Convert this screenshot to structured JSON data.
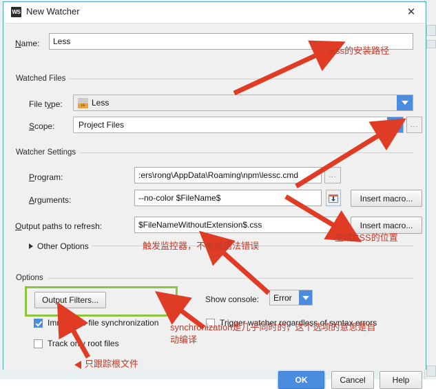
{
  "window": {
    "title": "New Watcher",
    "icon": "WS",
    "close_label": "✕"
  },
  "name_row": {
    "label": "Name:",
    "value": "Less"
  },
  "watched_files": {
    "group_label": "Watched Files",
    "file_type": {
      "label": "File type:",
      "value": "Less",
      "icon": "less-file-icon"
    },
    "scope": {
      "label": "Scope:",
      "value": "Project Files",
      "browse_label": "..."
    }
  },
  "watcher_settings": {
    "group_label": "Watcher Settings",
    "program": {
      "label": "Program:",
      "value": ":ers\\rong\\AppData\\Roaming\\npm\\lessc.cmd",
      "browse_label": "..."
    },
    "arguments": {
      "label": "Arguments:",
      "value": "--no-color $FileName$",
      "insert_macro_label": "Insert macro..."
    },
    "output_paths": {
      "label": "Output paths to refresh:",
      "value": "$FileNameWithoutExtension$.css",
      "insert_macro_label": "Insert macro..."
    },
    "other_options_label": "Other Options"
  },
  "options": {
    "group_label": "Options",
    "output_filters_label": "Output Filters...",
    "immediate_sync": {
      "label": "Immediate file synchronization",
      "checked": true
    },
    "track_only_root": {
      "label": "Track only root files",
      "checked": false
    },
    "show_console": {
      "label": "Show console:",
      "value": "Error"
    },
    "trigger_regardless": {
      "label": "Trigger watcher regardless of syntax errors",
      "checked": false
    }
  },
  "footer": {
    "ok_label": "OK",
    "cancel_label": "Cancel",
    "help_label": "Help"
  },
  "annotations": {
    "install_path": "less的安装路径",
    "generated_css": "生成CSS的位置",
    "trigger_watcher": "触发监控器，不考虑语法错误",
    "sync_line1": "synchronization是几乎同时的，这个选项的意思是自",
    "sync_line2": "动编译",
    "track_root": "只跟踪根文件"
  },
  "colors": {
    "accent_blue": "#4a8de0",
    "annotation_red": "#c0392b",
    "highlight_green": "#8cc63e",
    "dialog_border": "#4ea7b5"
  }
}
